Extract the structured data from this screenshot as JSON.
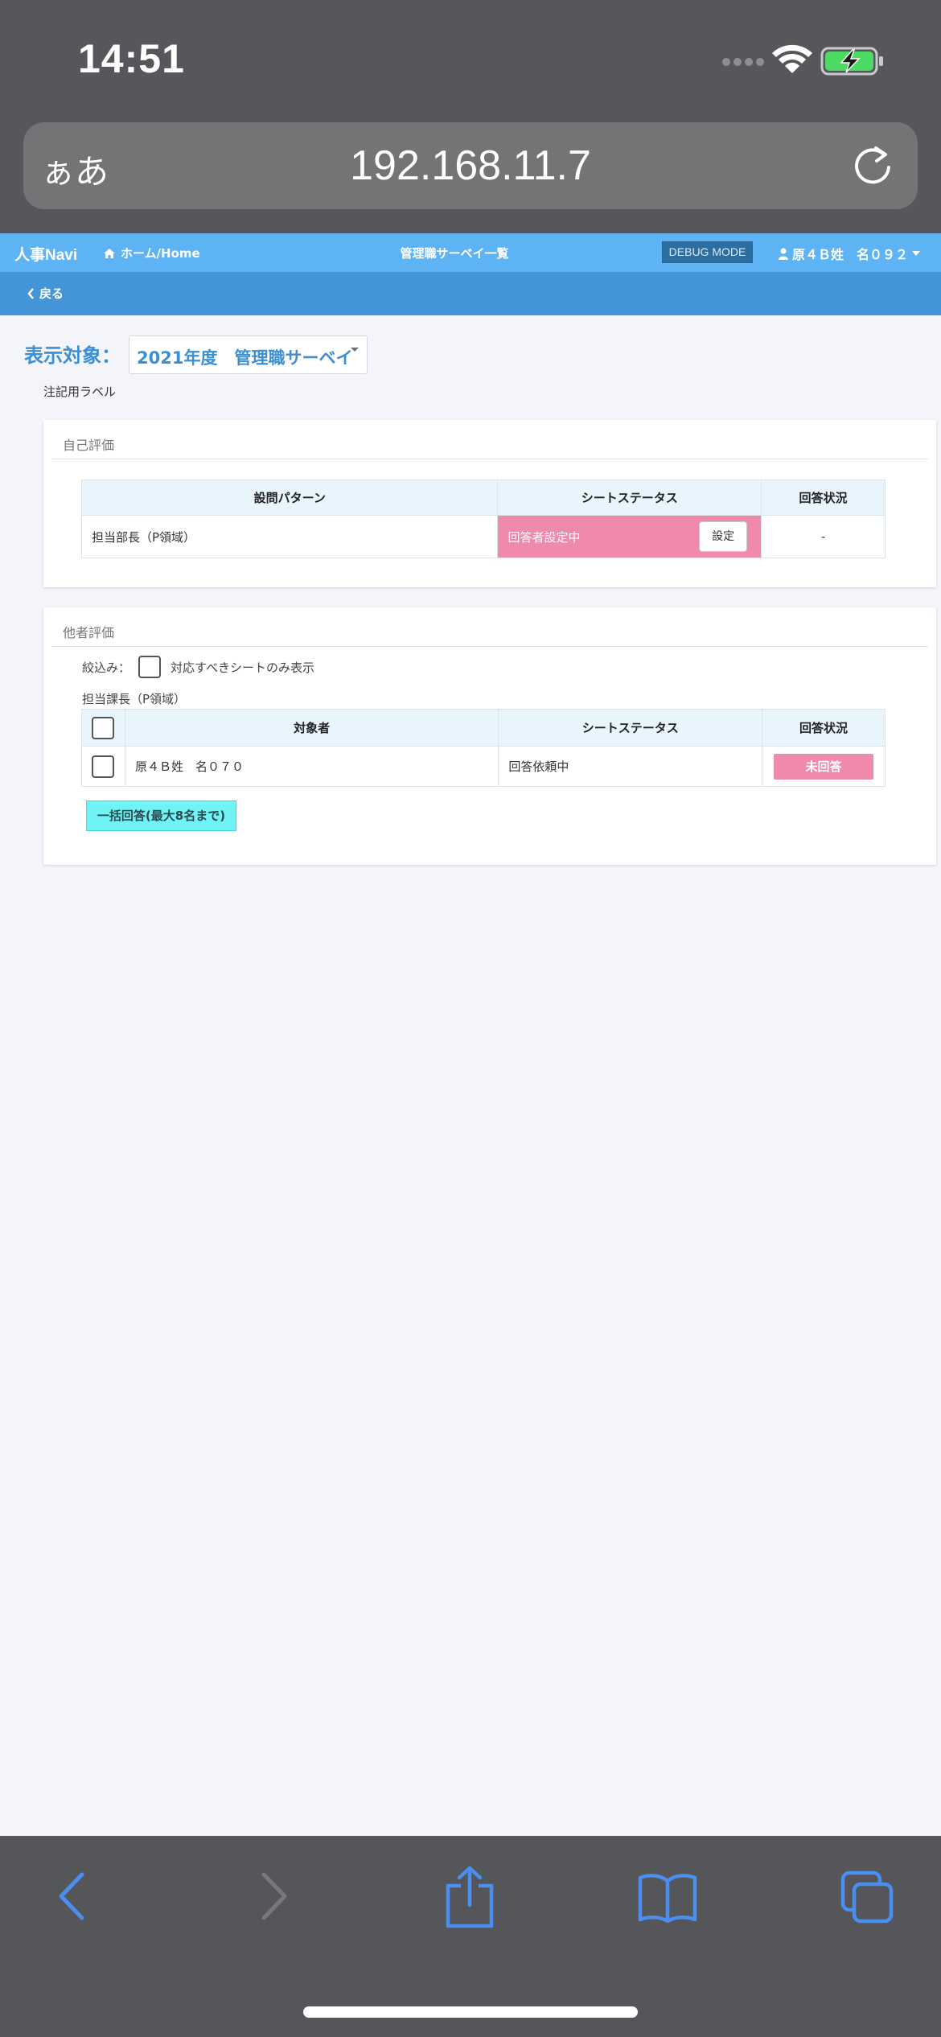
{
  "status_bar": {
    "time": "14:51"
  },
  "address_bar": {
    "text_size_label": "ぁあ",
    "url": "192.168.11.7"
  },
  "navbar": {
    "brand": "人事Navi",
    "home": "ホーム/Home",
    "title": "管理職サーベイ一覧",
    "debug_badge": "DEBUG MODE",
    "user": "原４Ｂ姓　名０９２"
  },
  "subbar": {
    "back": "戻る"
  },
  "target": {
    "label": "表示対象：",
    "selected": "2021年度　管理職サーベイ"
  },
  "note_label": "注記用ラベル",
  "self_eval": {
    "title": "自己評価",
    "headers": [
      "設問パターン",
      "シートステータス",
      "回答状況"
    ],
    "rows": [
      {
        "pattern": "担当部長（P領域）",
        "status": "回答者設定中",
        "action": "設定",
        "answer": "-"
      }
    ]
  },
  "other_eval": {
    "title": "他者評価",
    "filter_label": "絞込み：",
    "filter_option": "対応すべきシートのみ表示",
    "group_label": "担当課長（P領域）",
    "headers": [
      "対象者",
      "シートステータス",
      "回答状況"
    ],
    "rows": [
      {
        "target": "原４Ｂ姓　名０７０",
        "status": "回答依頼中",
        "answer": "未回答"
      }
    ],
    "bulk_button": "一括回答(最大8名まで)"
  },
  "colors": {
    "navbar": "#5eb3f5",
    "subbar": "#4495d7",
    "accent_blue": "#3a8fd6",
    "pink": "#f08aab",
    "cyan_button": "#6ff3f7"
  }
}
